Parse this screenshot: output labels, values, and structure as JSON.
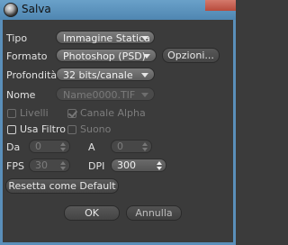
{
  "window": {
    "title": "Salva"
  },
  "form": {
    "tipo": {
      "label": "Tipo",
      "value": "Immagine Statica"
    },
    "formato": {
      "label": "Formato",
      "value": "Photoshop (PSD)",
      "options_button": "Opzioni..."
    },
    "profondita": {
      "label": "Profondità",
      "value": "32 bits/canale"
    },
    "nome": {
      "label": "Nome",
      "value": "Name0000.TIF"
    },
    "livelli": {
      "label": "Livelli",
      "checked": false
    },
    "canale_alpha": {
      "label": "Canale Alpha",
      "checked": true
    },
    "usa_filtro": {
      "label": "Usa Filtro",
      "checked": false
    },
    "suono": {
      "label": "Suono",
      "checked": false
    },
    "da": {
      "label": "Da",
      "value": "0"
    },
    "a": {
      "label": "A",
      "value": "0"
    },
    "fps": {
      "label": "FPS",
      "value": "30"
    },
    "dpi": {
      "label": "DPI",
      "value": "300"
    }
  },
  "buttons": {
    "reset": "Resetta come Default",
    "ok": "OK",
    "cancel": "Annulla"
  }
}
